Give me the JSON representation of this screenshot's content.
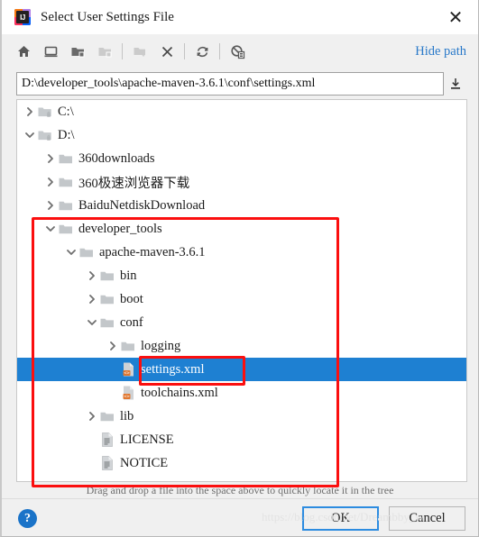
{
  "window": {
    "title": "Select User Settings File",
    "app_icon": "intellij-idea-icon",
    "logo_text": "IJ",
    "close_label": "✕"
  },
  "toolbar": {
    "icons": [
      {
        "name": "home-icon",
        "enabled": true
      },
      {
        "name": "desktop-icon",
        "enabled": true
      },
      {
        "name": "folder-up-icon",
        "enabled": true
      },
      {
        "name": "folder-icon",
        "enabled": false
      },
      {
        "name": "new-folder-icon",
        "enabled": false
      },
      {
        "name": "delete-icon",
        "enabled": true
      },
      {
        "name": "refresh-icon",
        "enabled": true
      },
      {
        "name": "show-hidden-icon",
        "enabled": true
      }
    ],
    "hide_path_label": "Hide path"
  },
  "path_field": {
    "value": "D:\\developer_tools\\apache-maven-3.6.1\\conf\\settings.xml",
    "placeholder": "",
    "dropdown_icon": "download-arrow-icon"
  },
  "tree": {
    "rows": [
      {
        "label": "C:\\",
        "indent": 0,
        "arrow": "collapsed",
        "icon": "drive-folder-icon",
        "selected": false
      },
      {
        "label": "D:\\",
        "indent": 0,
        "arrow": "expanded",
        "icon": "drive-folder-icon",
        "selected": false
      },
      {
        "label": "360downloads",
        "indent": 1,
        "arrow": "collapsed",
        "icon": "folder-icon",
        "selected": false
      },
      {
        "label": "360极速浏览器下载",
        "indent": 1,
        "arrow": "collapsed",
        "icon": "folder-icon",
        "selected": false
      },
      {
        "label": "BaiduNetdiskDownload",
        "indent": 1,
        "arrow": "collapsed",
        "icon": "folder-icon",
        "selected": false
      },
      {
        "label": "developer_tools",
        "indent": 1,
        "arrow": "expanded",
        "icon": "folder-icon",
        "selected": false
      },
      {
        "label": "apache-maven-3.6.1",
        "indent": 2,
        "arrow": "expanded",
        "icon": "folder-icon",
        "selected": false
      },
      {
        "label": "bin",
        "indent": 3,
        "arrow": "collapsed",
        "icon": "folder-icon",
        "selected": false
      },
      {
        "label": "boot",
        "indent": 3,
        "arrow": "collapsed",
        "icon": "folder-icon",
        "selected": false
      },
      {
        "label": "conf",
        "indent": 3,
        "arrow": "expanded",
        "icon": "folder-icon",
        "selected": false
      },
      {
        "label": "logging",
        "indent": 4,
        "arrow": "collapsed",
        "icon": "folder-icon",
        "selected": false
      },
      {
        "label": "settings.xml",
        "indent": 4,
        "arrow": "none",
        "icon": "xml-file-icon",
        "selected": true
      },
      {
        "label": "toolchains.xml",
        "indent": 4,
        "arrow": "none",
        "icon": "xml-file-icon",
        "selected": false
      },
      {
        "label": "lib",
        "indent": 3,
        "arrow": "collapsed",
        "icon": "folder-icon",
        "selected": false
      },
      {
        "label": "LICENSE",
        "indent": 3,
        "arrow": "none",
        "icon": "text-file-icon",
        "selected": false
      },
      {
        "label": "NOTICE",
        "indent": 3,
        "arrow": "none",
        "icon": "text-file-icon",
        "selected": false
      }
    ]
  },
  "hint_text": "Drag and drop a file into the space above to quickly locate it in the tree",
  "footer": {
    "help_label": "?",
    "ok_label": "OK",
    "cancel_label": "Cancel"
  },
  "watermark": "https://blog.csdn.net/Dreambby_w",
  "colors": {
    "selection": "#1e80d2",
    "link": "#2979c9",
    "annotation": "#fb0f0f",
    "focus_border": "#2d8ce0"
  }
}
